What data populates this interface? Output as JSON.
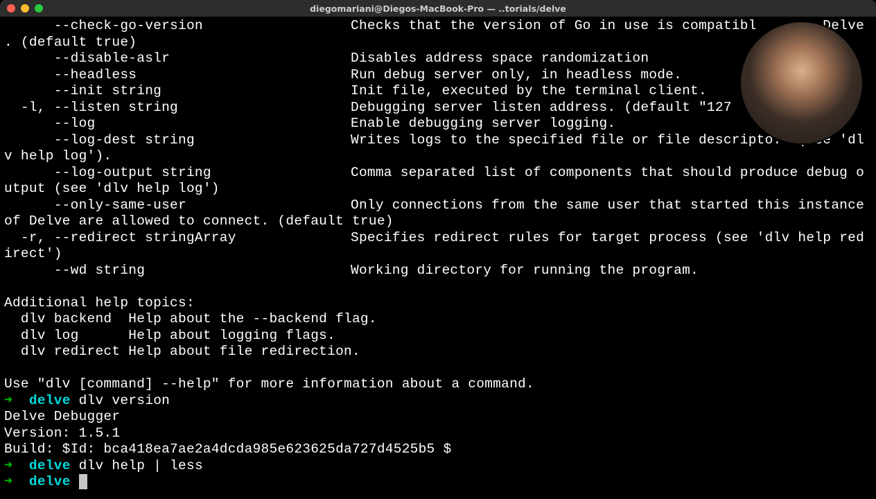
{
  "window": {
    "title": "diegomariani@Diegos-MacBook-Pro — ..torials/delve"
  },
  "flags": {
    "check_go_version": {
      "flag": "      --check-go-version",
      "desc": "Checks that the version of Go in use is compatibl        Delve"
    },
    "default_true_tail": ". (default true)",
    "disable_aslr": {
      "flag": "      --disable-aslr",
      "desc": "Disables address space randomization"
    },
    "headless": {
      "flag": "      --headless",
      "desc": "Run debug server only, in headless mode."
    },
    "init_string": {
      "flag": "      --init string",
      "desc": "Init file, executed by the terminal client."
    },
    "listen": {
      "flag": "  -l, --listen string",
      "desc": "Debugging server listen address. (default \"127"
    },
    "log": {
      "flag": "      --log",
      "desc": "Enable debugging server logging."
    },
    "log_dest": {
      "flag": "      --log-dest string",
      "desc": "Writes logs to the specified file or file descripto.  (see 'dlv help log')."
    },
    "log_output": {
      "flag": "      --log-output string",
      "desc": "Comma separated list of components that should produce debug output (see 'dlv help log')"
    },
    "only_same_user": {
      "flag": "      --only-same-user",
      "desc": "Only connections from the same user that started this instance of Delve are allowed to connect. (default true)"
    },
    "redirect": {
      "flag": "  -r, --redirect stringArray",
      "desc": "Specifies redirect rules for target process (see 'dlv help redirect')"
    },
    "wd": {
      "flag": "      --wd string",
      "desc": "Working directory for running the program."
    }
  },
  "help_topics": {
    "heading": "Additional help topics:",
    "backend": "  dlv backend  Help about the --backend flag.",
    "log": "  dlv log      Help about logging flags.",
    "redirect": "  dlv redirect Help about file redirection."
  },
  "footer_hint": "Use \"dlv [command] --help\" for more information about a command.",
  "prompts": {
    "arrow": "➜",
    "cwd": "delve",
    "cmd_version": "dlv version",
    "version_out_1": "Delve Debugger",
    "version_out_2": "Version: 1.5.1",
    "version_out_3": "Build: $Id: bca418ea7ae2a4dcda985e623625da727d4525b5 $",
    "cmd_help_less": "dlv help | less",
    "cmd_current": ""
  }
}
